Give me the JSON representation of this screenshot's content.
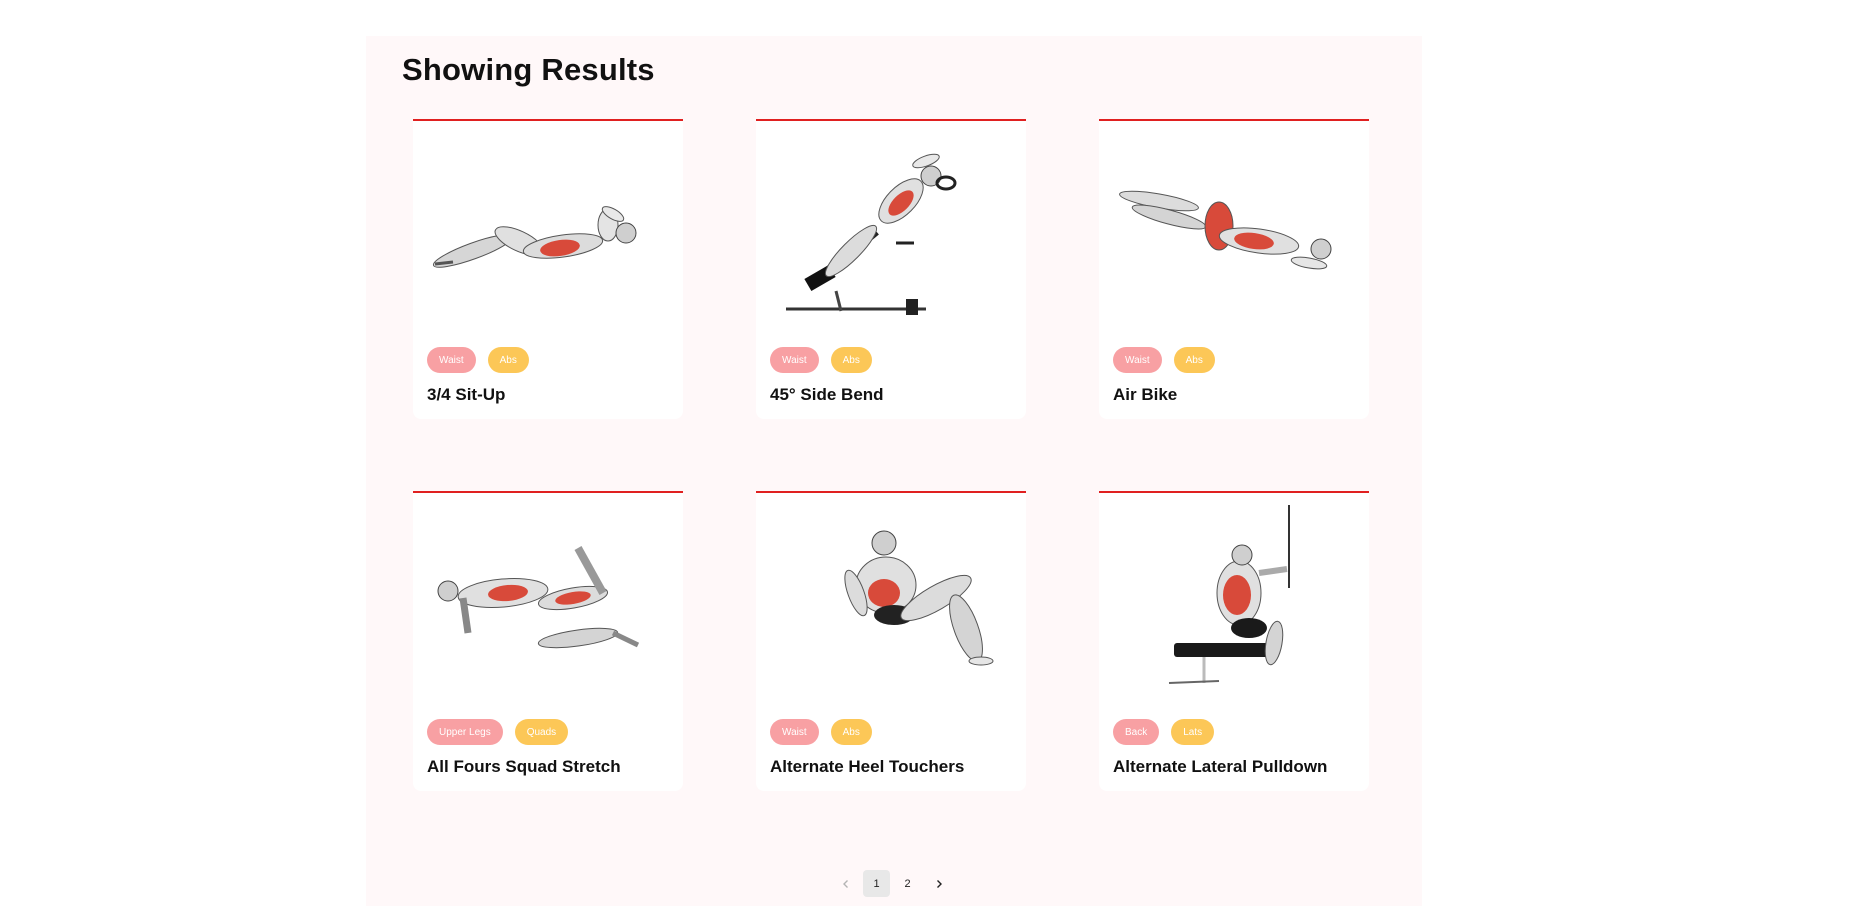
{
  "results": {
    "heading": "Showing Results",
    "exercises": [
      {
        "name": "3/4 Sit-Up",
        "body_part": "Waist",
        "target": "Abs",
        "icon": "situp-figure-icon"
      },
      {
        "name": "45° Side Bend",
        "body_part": "Waist",
        "target": "Abs",
        "icon": "side-bend-figure-icon"
      },
      {
        "name": "Air Bike",
        "body_part": "Waist",
        "target": "Abs",
        "icon": "air-bike-figure-icon"
      },
      {
        "name": "All Fours Squad Stretch",
        "body_part": "Upper Legs",
        "target": "Quads",
        "icon": "quad-stretch-figure-icon"
      },
      {
        "name": "Alternate Heel Touchers",
        "body_part": "Waist",
        "target": "Abs",
        "icon": "heel-touchers-figure-icon"
      },
      {
        "name": "Alternate Lateral Pulldown",
        "body_part": "Back",
        "target": "Lats",
        "icon": "lateral-pulldown-figure-icon"
      }
    ]
  },
  "pagination": {
    "prev_icon": "chevron-left-icon",
    "next_icon": "chevron-right-icon",
    "pages": [
      "1",
      "2"
    ],
    "current_page": 1
  },
  "colors": {
    "accent_line": "#e02020",
    "body_part_tag": "#f8a0a3",
    "target_tag": "#fcc757",
    "muscle_highlight": "#d84a3a",
    "page_background": "#fff8f9"
  }
}
